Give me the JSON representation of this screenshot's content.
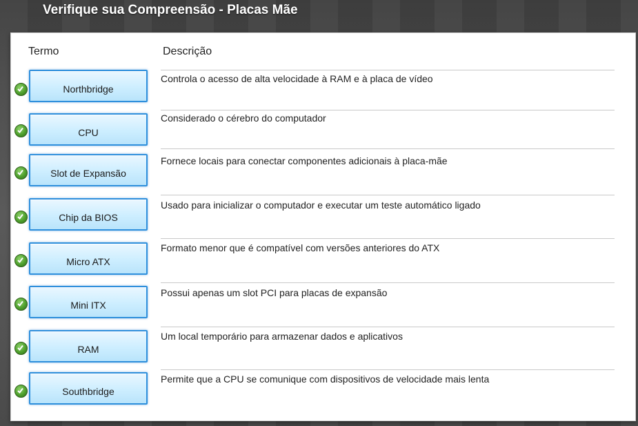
{
  "title": "Verifique sua Compreensão - Placas Mãe",
  "headers": {
    "term": "Termo",
    "description": "Descrição"
  },
  "rows": [
    {
      "term": "Northbridge",
      "description": "Controla o acesso de alta velocidade à RAM e à placa de vídeo",
      "status": "correct"
    },
    {
      "term": "CPU",
      "description": "Considerado o cérebro do computador",
      "status": "correct"
    },
    {
      "term": "Slot de Expansão",
      "description": "Fornece locais para conectar componentes adicionais à placa-mãe",
      "status": "correct"
    },
    {
      "term": "Chip da BIOS",
      "description": "Usado para inicializar o computador e executar um teste automático ligado",
      "status": "correct"
    },
    {
      "term": "Micro ATX",
      "description": "Formato menor que é compatível com versões anteriores do ATX",
      "status": "correct"
    },
    {
      "term": "Mini ITX",
      "description": "Possui apenas um slot PCI para placas de expansão",
      "status": "correct"
    },
    {
      "term": "RAM",
      "description": "Um local temporário para armazenar dados e aplicativos",
      "status": "correct"
    },
    {
      "term": "Southbridge",
      "description": "Permite que a CPU se comunique com dispositivos de velocidade mais lenta",
      "status": "correct"
    }
  ],
  "colors": {
    "accent": "#2e8fdc",
    "check": "#4e9f2d"
  }
}
